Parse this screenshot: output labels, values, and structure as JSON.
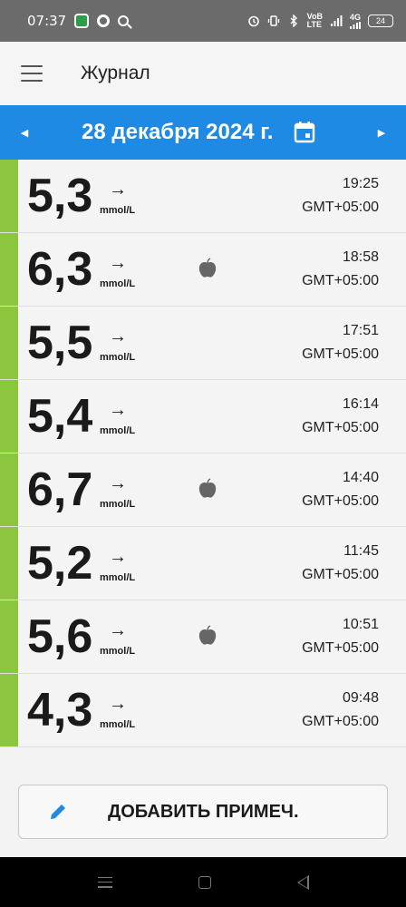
{
  "status_bar": {
    "time": "07:37",
    "net_top": "VoB",
    "net_bottom": "LTE",
    "signal": "4G",
    "battery": "24"
  },
  "app_bar": {
    "title": "Журнал"
  },
  "date_bar": {
    "date": "28 декабря 2024 г.",
    "prev_arrow": "◀",
    "next_arrow": "▶"
  },
  "unit": "mmol/L",
  "trend_arrow": "→",
  "readings": [
    {
      "value": "5,3",
      "time": "19:25",
      "tz": "GMT+05:00",
      "food": false
    },
    {
      "value": "6,3",
      "time": "18:58",
      "tz": "GMT+05:00",
      "food": true
    },
    {
      "value": "5,5",
      "time": "17:51",
      "tz": "GMT+05:00",
      "food": false
    },
    {
      "value": "5,4",
      "time": "16:14",
      "tz": "GMT+05:00",
      "food": false
    },
    {
      "value": "6,7",
      "time": "14:40",
      "tz": "GMT+05:00",
      "food": true
    },
    {
      "value": "5,2",
      "time": "11:45",
      "tz": "GMT+05:00",
      "food": false
    },
    {
      "value": "5,6",
      "time": "10:51",
      "tz": "GMT+05:00",
      "food": true
    },
    {
      "value": "4,3",
      "time": "09:48",
      "tz": "GMT+05:00",
      "food": false
    }
  ],
  "add_note_button": {
    "label": "ДОБАВИТЬ ПРИМЕЧ."
  },
  "colors": {
    "accent": "#1f8ae3",
    "in_range": "#8cc63f"
  }
}
